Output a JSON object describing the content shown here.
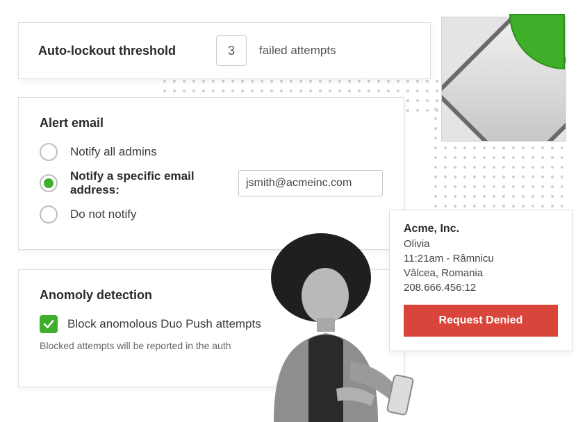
{
  "colors": {
    "accent": "#3fae29",
    "danger": "#d9453a"
  },
  "lockout": {
    "title": "Auto-lockout threshold",
    "value": "3",
    "suffix": "failed attempts"
  },
  "alert": {
    "title": "Alert email",
    "options": [
      {
        "label": "Notify all admins",
        "selected": false
      },
      {
        "label": "Notify a specific email address:",
        "selected": true
      },
      {
        "label": "Do not notify",
        "selected": false
      }
    ],
    "email_value": "jsmith@acmeinc.com"
  },
  "anomaly": {
    "title": "Anomoly detection",
    "checkbox_label": "Block anomolous Duo Push attempts",
    "checked": true,
    "helper": "Blocked attempts will be reported in the auth"
  },
  "notification": {
    "org": "Acme, Inc.",
    "user": "Olivia",
    "time_location": "11:21am - Râmnicu",
    "location2": "Vâlcea, Romania",
    "ip": "208.666.456:12",
    "button": "Request Denied"
  }
}
